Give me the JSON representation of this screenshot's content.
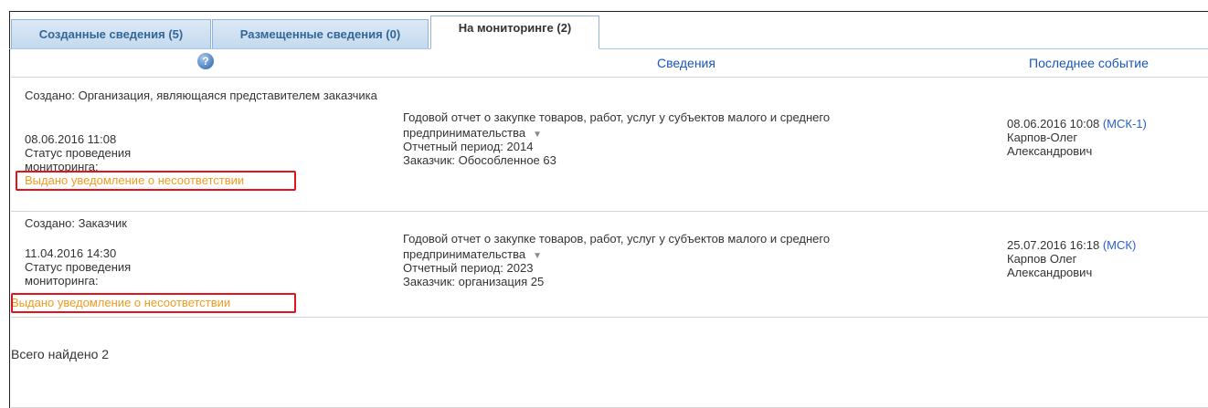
{
  "tabs": [
    {
      "label": "Созданные сведения (5)"
    },
    {
      "label": "Размещенные сведения (0)"
    },
    {
      "label": "На мониторинге (2)"
    }
  ],
  "columns": {
    "help_icon_glyph": "?",
    "info": "Сведения",
    "last_event": "Последнее событие"
  },
  "rows": [
    {
      "created": "Создано: Организация, являющаяся представителем заказчика",
      "date": "08.06.2016 11:08",
      "status_label_1": "Статус проведения",
      "status_label_2": "мониторинга:",
      "status_value": "Выдано уведомление о несоответствии",
      "doc_line1": "Годовой отчет о закупке товаров, работ, услуг у субъектов малого и среднего",
      "doc_line2": "предпринимательства",
      "period": "Отчетный период: 2014",
      "customer": "Заказчик: Обособленное 63",
      "event_time": "08.06.2016 10:08",
      "event_tz": "(МСК-1)",
      "event_user_1": "Карпов-Олег",
      "event_user_2": "Александрович"
    },
    {
      "created": "Создано: Заказчик",
      "date": "11.04.2016 14:30",
      "status_label_1": "Статус проведения",
      "status_label_2": "мониторинга:",
      "status_value": "Выдано уведомление о несоответствии",
      "doc_line1": "Годовой отчет о закупке товаров, работ, услуг у субъектов малого и среднего",
      "doc_line2": "предпринимательства",
      "period": "Отчетный период: 2023",
      "customer": "Заказчик: организация 25",
      "event_time": "25.07.2016 16:18",
      "event_tz": "(МСК)",
      "event_user_1": "Карпов Олег",
      "event_user_2": "Александрович"
    }
  ],
  "footer": {
    "total": "Всего найдено 2"
  },
  "colors": {
    "tab_text": "#336699",
    "header_link": "#1a55b8",
    "status_orange": "#f29b1d",
    "highlight_red": "#e0141c",
    "timezone_blue": "#2860cc"
  },
  "icons": {
    "help": "help-icon",
    "dropdown": "chevron-down-icon"
  }
}
